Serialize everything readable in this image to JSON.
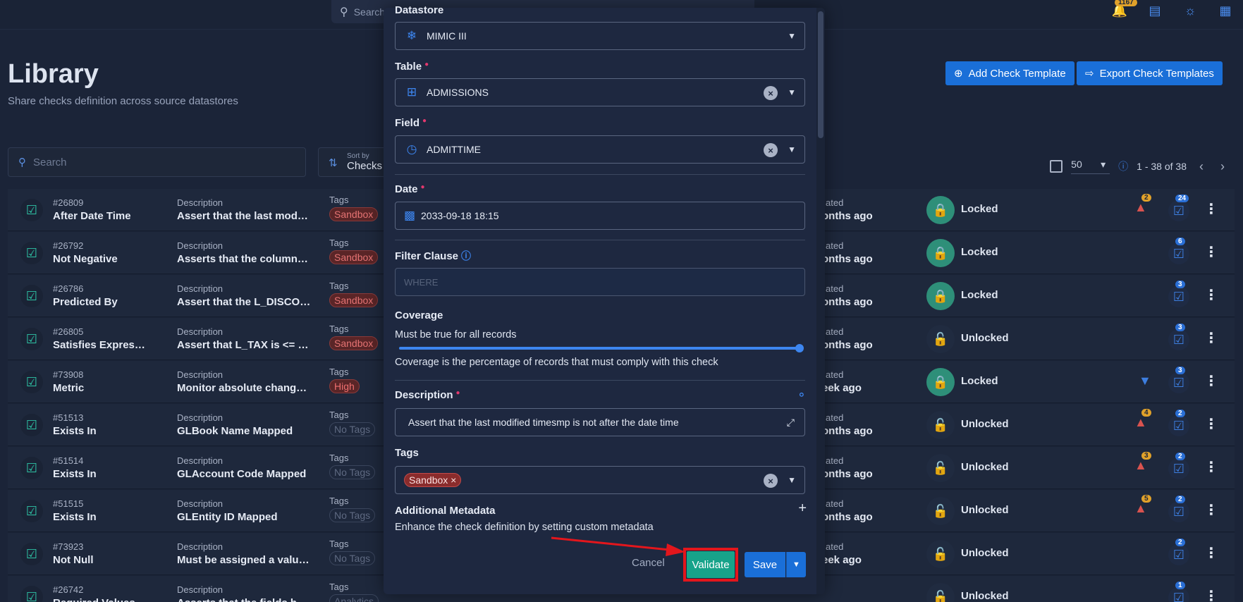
{
  "topbar": {
    "search_placeholder": "Search",
    "bell_badge": "1167"
  },
  "header": {
    "title": "Library",
    "subtitle": "Share checks definition across source datastores",
    "add_template_label": "Add Check Template",
    "export_templates_label": "Export Check Templates"
  },
  "toolbar": {
    "search_placeholder": "Search",
    "sort_caption": "Sort by",
    "sort_value": "Checks",
    "per_page": "50",
    "range": "1 - 38 of 38"
  },
  "rows": [
    {
      "id": "#26809",
      "name": "After Date Time",
      "desc_label": "Description",
      "desc": "Assert that the last modifie...",
      "tags_label": "Tags",
      "tag": "Sandbox",
      "upd_label": "ated",
      "upd": "onths ago",
      "lock": "Locked",
      "warn": "2",
      "checks": "24"
    },
    {
      "id": "#26792",
      "name": "Not Negative",
      "desc_label": "Description",
      "desc": "Asserts that the columns ar...",
      "tags_label": "Tags",
      "tag": "Sandbox",
      "upd_label": "ated",
      "upd": "onths ago",
      "lock": "Locked",
      "warn": "",
      "checks": "6"
    },
    {
      "id": "#26786",
      "name": "Predicted By",
      "desc_label": "Description",
      "desc": "Assert that the L_DISCOUN...",
      "tags_label": "Tags",
      "tag": "Sandbox",
      "upd_label": "ated",
      "upd": "onths ago",
      "lock": "Locked",
      "warn": "",
      "checks": "3"
    },
    {
      "id": "#26805",
      "name": "Satisfies Expressi...",
      "desc_label": "Description",
      "desc": "Assert that L_TAX is <= tha...",
      "tags_label": "Tags",
      "tag": "Sandbox",
      "upd_label": "ated",
      "upd": "onths ago",
      "lock": "Unlocked",
      "warn": "",
      "checks": "3"
    },
    {
      "id": "#73908",
      "name": "Metric",
      "desc_label": "Description",
      "desc": "Monitor absolute change in ...",
      "tags_label": "Tags",
      "tag": "High",
      "upd_label": "ated",
      "upd": "eek ago",
      "lock": "Locked",
      "warn": "",
      "checks": "3"
    },
    {
      "id": "#51513",
      "name": "Exists In",
      "desc_label": "Description",
      "desc": "GLBook Name Mapped",
      "tags_label": "Tags",
      "tag": "No Tags",
      "upd_label": "ated",
      "upd": "onths ago",
      "lock": "Unlocked",
      "warn": "4",
      "checks": "2"
    },
    {
      "id": "#51514",
      "name": "Exists In",
      "desc_label": "Description",
      "desc": "GLAccount Code Mapped",
      "tags_label": "Tags",
      "tag": "No Tags",
      "upd_label": "ated",
      "upd": "onths ago",
      "lock": "Unlocked",
      "warn": "3",
      "checks": "2"
    },
    {
      "id": "#51515",
      "name": "Exists In",
      "desc_label": "Description",
      "desc": "GLEntity ID Mapped",
      "tags_label": "Tags",
      "tag": "No Tags",
      "upd_label": "ated",
      "upd": "onths ago",
      "lock": "Unlocked",
      "warn": "5",
      "checks": "2"
    },
    {
      "id": "#73923",
      "name": "Not Null",
      "desc_label": "Description",
      "desc": "Must be assigned a value for...",
      "tags_label": "Tags",
      "tag": "No Tags",
      "upd_label": "ated",
      "upd": "eek ago",
      "lock": "Unlocked",
      "warn": "",
      "checks": "2"
    },
    {
      "id": "#26742",
      "name": "Required Values",
      "desc_label": "Description",
      "desc": "Asserts that the fields have...",
      "tags_label": "Tags",
      "tag": "Analytics",
      "upd_label": "",
      "upd": "",
      "lock": "Unlocked",
      "warn": "",
      "checks": "1"
    }
  ],
  "modal": {
    "datastore_label": "Datastore",
    "datastore_value": "MIMIC III",
    "table_label": "Table",
    "table_value": "ADMISSIONS",
    "field_label": "Field",
    "field_value": "ADMITTIME",
    "date_label": "Date",
    "date_value": "2033-09-18 18:15",
    "filter_label": "Filter Clause",
    "filter_placeholder": "WHERE",
    "coverage_label": "Coverage",
    "coverage_rule": "Must be true for all records",
    "coverage_help": "Coverage is the percentage of records that must comply with this check",
    "coverage_fraction": 1.0,
    "description_label": "Description",
    "description_value": "Assert that the last modified timesmp is not after the date time",
    "tags_label": "Tags",
    "tag_chip": "Sandbox",
    "metadata_label": "Additional Metadata",
    "metadata_help": "Enhance the check definition by setting custom metadata",
    "cancel_label": "Cancel",
    "validate_label": "Validate",
    "save_label": "Save"
  },
  "colors": {
    "accent": "#1a6fd8",
    "validate": "#17a38a",
    "annotation": "#e3161c",
    "required": "#e3386e"
  }
}
